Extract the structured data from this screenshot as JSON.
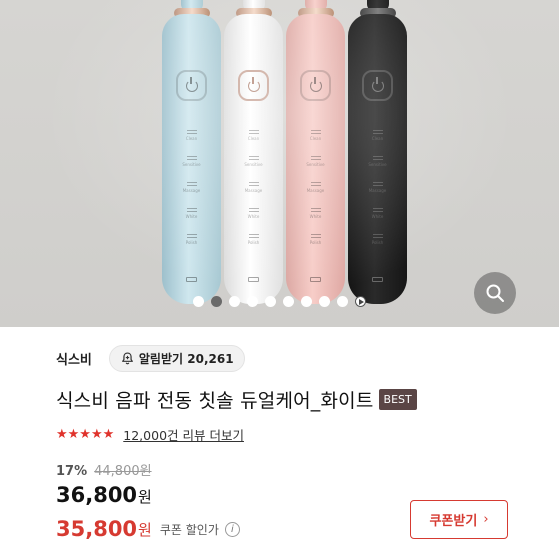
{
  "brand": {
    "name": "식스비"
  },
  "follow": {
    "label": "알림받기",
    "count": "20,261"
  },
  "product": {
    "title": "식스비 음파 전동 칫솔 듀얼케어_화이트",
    "badge": "BEST"
  },
  "rating": {
    "stars": "★★★★★",
    "review_link": "12,000건 리뷰 더보기"
  },
  "pricing": {
    "discount_rate": "17%",
    "original_price": "44,800원",
    "sale_price": "36,800",
    "sale_unit": "원",
    "coupon_price": "35,800",
    "coupon_unit": "원",
    "coupon_label": "쿠폰 할인가",
    "info_icon": "i"
  },
  "coupon_button": {
    "label": "쿠폰받기",
    "chevron": "›"
  },
  "gallery": {
    "total_slides": 10,
    "active_index": 1
  },
  "brush_modes": [
    "Clean",
    "Sensitive",
    "Massage",
    "White",
    "Polish"
  ],
  "colors": {
    "accent_red": "#d63a31",
    "badge_brown": "#5a4545"
  }
}
